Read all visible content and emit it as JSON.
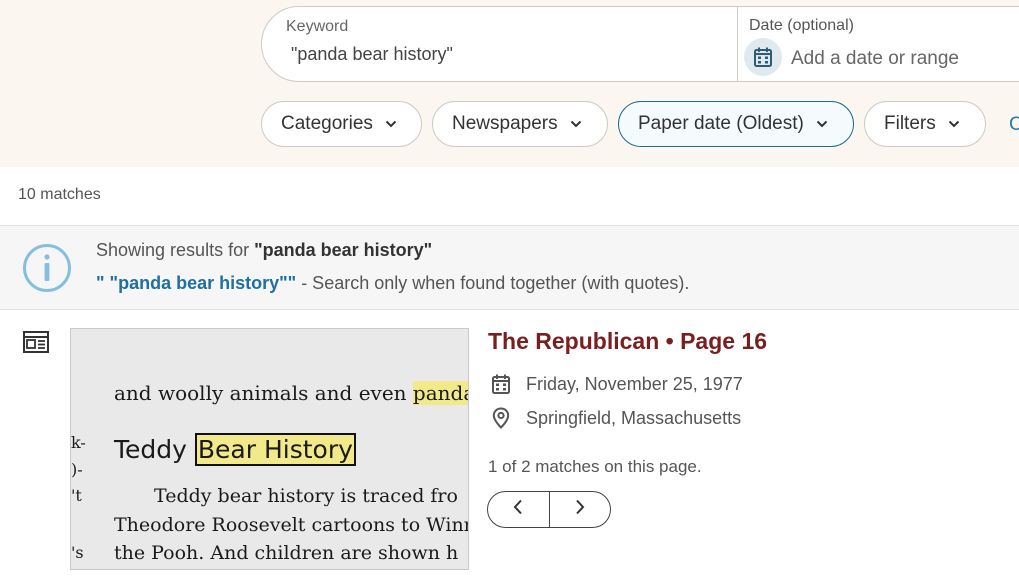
{
  "search": {
    "keyword_label": "Keyword",
    "keyword_value": "\"panda bear history\"",
    "date_label": "Date (optional)",
    "date_placeholder": "Add a date or range"
  },
  "filters": {
    "categories": "Categories",
    "newspapers": "Newspapers",
    "sort": "Paper date (Oldest)",
    "filters": "Filters",
    "clear": "C"
  },
  "results": {
    "count": "10 matches"
  },
  "notice": {
    "showing_prefix": "Showing results for",
    "query": "\"panda bear history\"",
    "alt_query": "\" \"panda bear history\"\"",
    "alt_suffix": " - Search only when found together (with quotes)."
  },
  "result": {
    "title": "The Republican • Page 16",
    "date": "Friday, November 25, 1977",
    "location": "Springfield, Massachusetts",
    "match_info": "1 of 2 matches on this page.",
    "snippet": {
      "line1_pre": "and woolly animals and even ",
      "line1_hl": "pandas",
      "line1_post": ".",
      "heading_pre": "Teddy ",
      "heading_hl": "Bear History",
      "line3": "Teddy bear history is traced fro",
      "line4": "Theodore Roosevelt cartoons to Winn",
      "line5": "the Pooh. And children are shown h",
      "margin": [
        "k-",
        ")-",
        "'t",
        "'s"
      ]
    }
  },
  "icons": {
    "calendar": "calendar-icon",
    "chevron": "chevron-down-icon",
    "info": "info-icon",
    "newspaper": "newspaper-icon",
    "pin": "location-pin-icon",
    "prev": "chevron-left-icon",
    "next": "chevron-right-icon"
  },
  "colors": {
    "band": "#fbf6ef",
    "title": "#7a1f1f",
    "link": "#1f6fa0",
    "active_border": "#1e6a8a",
    "highlight": "#f2e98a"
  }
}
